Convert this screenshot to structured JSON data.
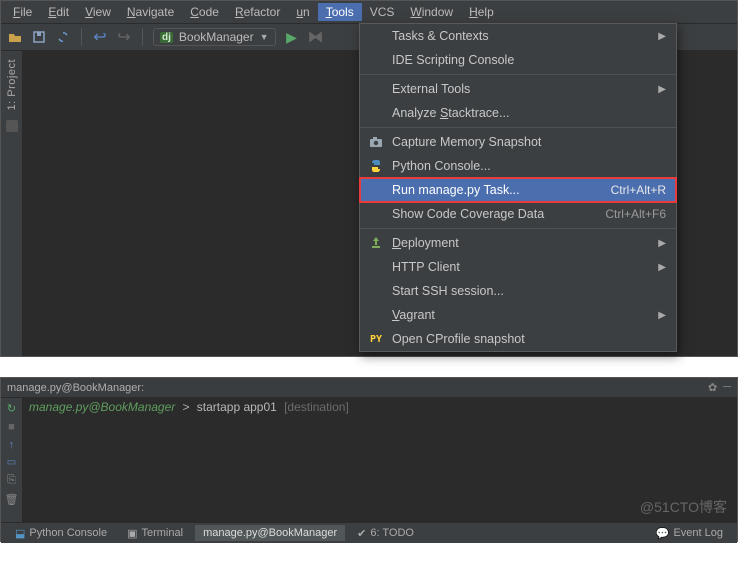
{
  "menubar": [
    {
      "label": "File",
      "u": 0
    },
    {
      "label": "Edit",
      "u": 0
    },
    {
      "label": "View",
      "u": 0
    },
    {
      "label": "Navigate",
      "u": 0
    },
    {
      "label": "Code",
      "u": 0
    },
    {
      "label": "Refactor",
      "u": 0
    },
    {
      "label": "Run",
      "u": 1
    },
    {
      "label": "Tools",
      "u": 0,
      "open": true
    },
    {
      "label": "VCS",
      "u": -1
    },
    {
      "label": "Window",
      "u": 0
    },
    {
      "label": "Help",
      "u": 0
    }
  ],
  "toolbar": {
    "run_config": "BookManager"
  },
  "sidebar": {
    "project_label": "1: Project"
  },
  "tools_menu": [
    {
      "label": "Tasks & Contexts",
      "submenu": true
    },
    {
      "label": "IDE Scripting Console"
    },
    {
      "sep": true
    },
    {
      "label": "External Tools",
      "submenu": true
    },
    {
      "label": "Analyze Stacktrace...",
      "mn": "S"
    },
    {
      "sep": true
    },
    {
      "icon": "camera",
      "label": "Capture Memory Snapshot"
    },
    {
      "icon": "python",
      "label": "Python Console..."
    },
    {
      "label": "Run manage.py Task...",
      "shortcut": "Ctrl+Alt+R",
      "hl": true
    },
    {
      "label": "Show Code Coverage Data",
      "shortcut": "Ctrl+Alt+F6"
    },
    {
      "sep": true
    },
    {
      "icon": "deploy",
      "label": "Deployment",
      "submenu": true,
      "mn": "D"
    },
    {
      "label": "HTTP Client",
      "submenu": true
    },
    {
      "label": "Start SSH session..."
    },
    {
      "label": "Vagrant",
      "submenu": true,
      "mn": "V"
    },
    {
      "icon": "py",
      "label": "Open CProfile snapshot"
    }
  ],
  "terminal": {
    "header": "manage.py@BookManager:",
    "prompt": "manage.py@BookManager",
    "arrow": ">",
    "command": "startapp app01",
    "hint": "[destination]"
  },
  "statusbar": {
    "tabs": [
      {
        "icon": "python",
        "label": "Python Console"
      },
      {
        "icon": "terminal",
        "label": "Terminal"
      },
      {
        "label": "manage.py@BookManager",
        "active": true
      },
      {
        "icon": "todo",
        "label": "6: TODO"
      }
    ],
    "event_log": "Event Log"
  },
  "watermark": "@51CTO博客"
}
